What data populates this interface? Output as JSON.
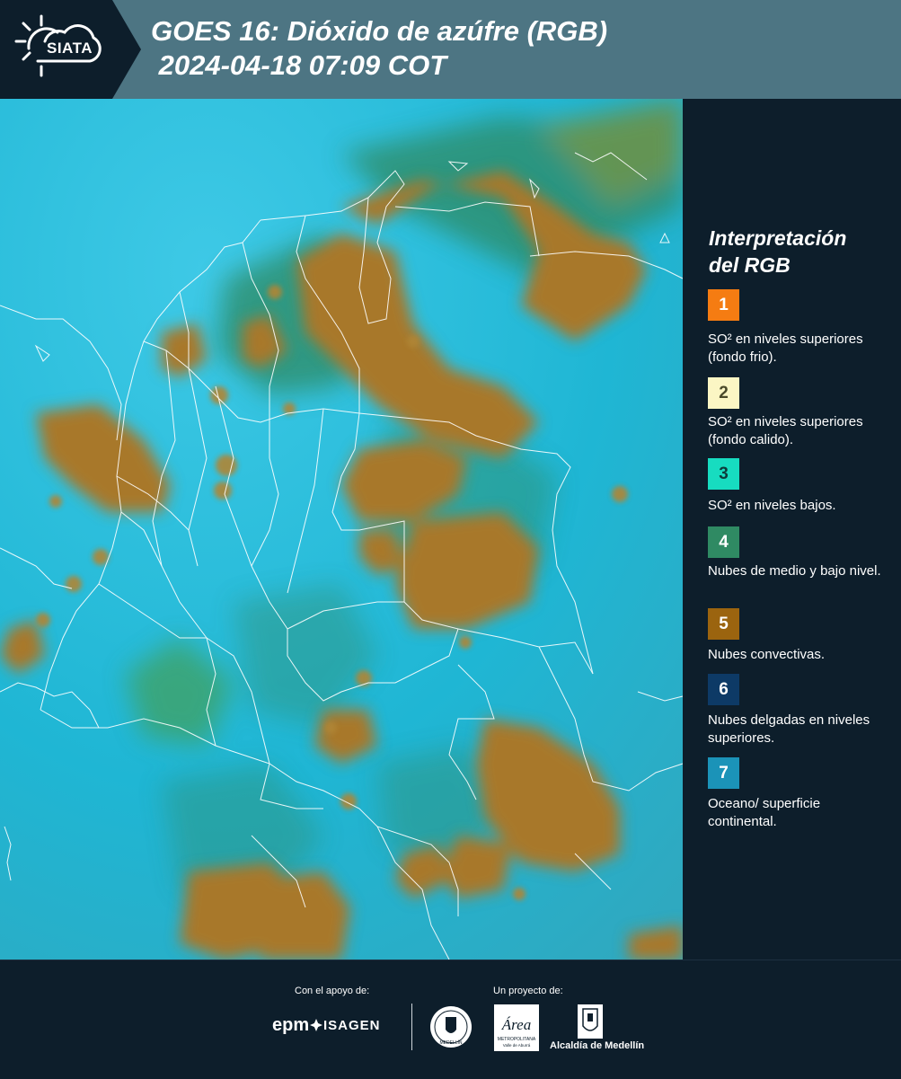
{
  "header": {
    "logo_text": "SIATA",
    "title_line1": "GOES 16: Dióxido de azúfre (RGB)",
    "title_line2": " 2024-04-18 07:09 COT"
  },
  "legend": {
    "title_line1": "Interpretación",
    "title_line2": "del RGB",
    "items": [
      {
        "num": "1",
        "color": "#f57c12",
        "text": "SO² en niveles superiores (fondo frio)."
      },
      {
        "num": "2",
        "color": "#fbf6c4",
        "text": "SO² en niveles superiores (fondo calido)."
      },
      {
        "num": "3",
        "color": "#17dcc0",
        "text": "SO² en niveles bajos."
      },
      {
        "num": "4",
        "color": "#2f8a63",
        "text": "Nubes de medio y bajo nivel."
      },
      {
        "num": "5",
        "color": "#9b640f",
        "text": "Nubes convectivas."
      },
      {
        "num": "6",
        "color": "#0d3a66",
        "text": "Nubes delgadas en niveles superiores."
      },
      {
        "num": "7",
        "color": "#1b93b8",
        "text": "Oceano/ superficie continental."
      }
    ]
  },
  "footer": {
    "support_label": "Con el apoyo de:",
    "project_label": "Un proyecto de:",
    "epm": "epm",
    "isagen": "ISAGEN",
    "area_text": "Área",
    "area_sub": "METROPOLITANA",
    "area_sub2": "Valle de Aburrá",
    "medellin_seal_text": "MEDELLÍN",
    "alcaldia": "Alcaldía de Medellín"
  },
  "map": {
    "ocean_color": "#1fb6d4",
    "cloud_color": "#a8782a",
    "vegetation_color": "#2f8a63",
    "border_color": "#ffffff"
  }
}
